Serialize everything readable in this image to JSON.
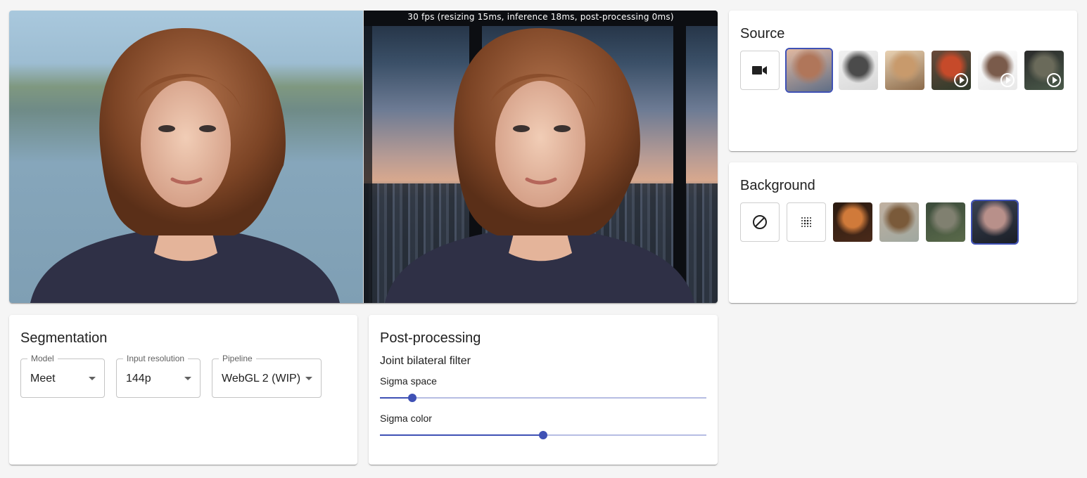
{
  "viewer": {
    "fps_text": "30 fps (resizing 15ms, inference 18ms, post-processing 0ms)"
  },
  "source": {
    "title": "Source",
    "items": [
      {
        "icon": "video-camera-icon",
        "kind": "camera"
      },
      {
        "kind": "image",
        "selected": true,
        "colors": [
          "#5f6e86",
          "#b0765a",
          "#e1b8a0"
        ]
      },
      {
        "kind": "image",
        "colors": [
          "#d8d8d8",
          "#4b4b4b",
          "#f2f2f2"
        ]
      },
      {
        "kind": "image",
        "colors": [
          "#8b6a4a",
          "#c89a6c",
          "#e9d2b3"
        ]
      },
      {
        "kind": "video",
        "colors": [
          "#2e3a2a",
          "#c64a2a",
          "#6a4a3a"
        ]
      },
      {
        "kind": "video",
        "colors": [
          "#e8e8e8",
          "#7a5b4b",
          "#ffffff"
        ]
      },
      {
        "kind": "video",
        "colors": [
          "#4a5a4a",
          "#6a6a5a",
          "#2a2a2a"
        ]
      }
    ]
  },
  "background": {
    "title": "Background",
    "items": [
      {
        "icon": "no-background-icon",
        "kind": "none"
      },
      {
        "icon": "blur-icon",
        "kind": "blur"
      },
      {
        "kind": "image",
        "colors": [
          "#4a2a1a",
          "#d07a3a",
          "#2a1a10"
        ]
      },
      {
        "kind": "image",
        "colors": [
          "#a0a8a0",
          "#7a5a3a",
          "#c0b0a0"
        ]
      },
      {
        "kind": "image",
        "colors": [
          "#5a6a4a",
          "#808070",
          "#3a4a3a"
        ]
      },
      {
        "kind": "image",
        "selected": true,
        "colors": [
          "#1a1e26",
          "#b8908a",
          "#3a4252"
        ]
      }
    ]
  },
  "segmentation": {
    "title": "Segmentation",
    "model_label": "Model",
    "model_value": "Meet",
    "resolution_label": "Input resolution",
    "resolution_value": "144p",
    "pipeline_label": "Pipeline",
    "pipeline_value": "WebGL 2 (WIP)"
  },
  "post_processing": {
    "title": "Post-processing",
    "filter_title": "Joint bilateral filter",
    "sigma_space_label": "Sigma space",
    "sigma_space_fraction": 0.1,
    "sigma_color_label": "Sigma color",
    "sigma_color_fraction": 0.5,
    "accent": "#3f51b5"
  }
}
